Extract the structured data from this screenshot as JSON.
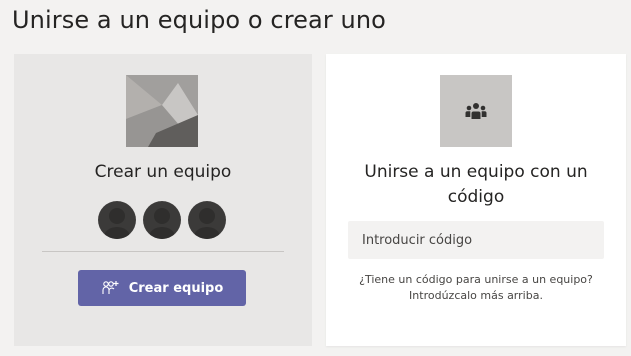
{
  "page": {
    "title": "Unirse a un equipo o crear uno"
  },
  "create_card": {
    "title": "Crear un equipo",
    "image_icon": "team-picture-placeholder",
    "avatars": [
      "avatar",
      "avatar",
      "avatar"
    ],
    "button_label": "Crear equipo",
    "button_icon": "add-team-icon"
  },
  "join_card": {
    "icon": "people-group-icon",
    "title": "Unirse a un equipo con un código",
    "input_placeholder": "Introducir código",
    "input_value": "",
    "hint": "¿Tiene un código para unirse a un equipo? Introdúzcalo más arriba."
  },
  "colors": {
    "background": "#f3f2f1",
    "create_card_bg": "#e8e7e6",
    "join_card_bg": "#ffffff",
    "accent": "#6264a7",
    "avatar": "#3b3a39",
    "icon_box": "#c8c6c4"
  }
}
